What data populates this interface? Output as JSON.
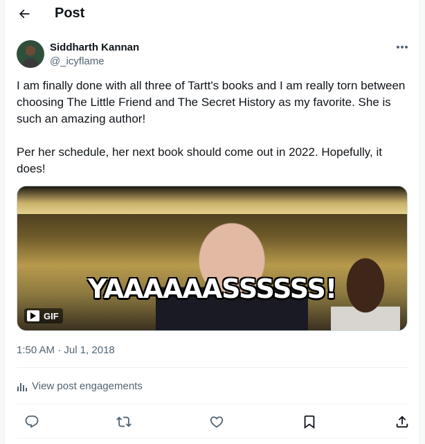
{
  "header": {
    "title": "Post",
    "back_icon": "arrow-left-icon"
  },
  "author": {
    "display_name": "Siddharth Kannan",
    "handle": "@_icyflame"
  },
  "tweet": {
    "paragraphs": [
      "I am finally done with all three of Tartt's books and I am really torn between choosing The Little Friend and The Secret History as my favorite. She is such an amazing author!",
      "Per her schedule, her next book should come out in 2022. Hopefully, it does!"
    ],
    "media": {
      "caption": "YAAAAAASSSSSS!",
      "badge_label": "GIF"
    },
    "timestamp": "1:50 AM · Jul 1, 2018"
  },
  "engagements": {
    "label": "View post engagements"
  },
  "actions": {
    "icons": [
      "reply-icon",
      "repost-icon",
      "like-icon",
      "bookmark-icon",
      "share-icon"
    ]
  },
  "colors": {
    "text": "#0f1419",
    "secondary": "#536471",
    "divider": "#eff3f4"
  }
}
